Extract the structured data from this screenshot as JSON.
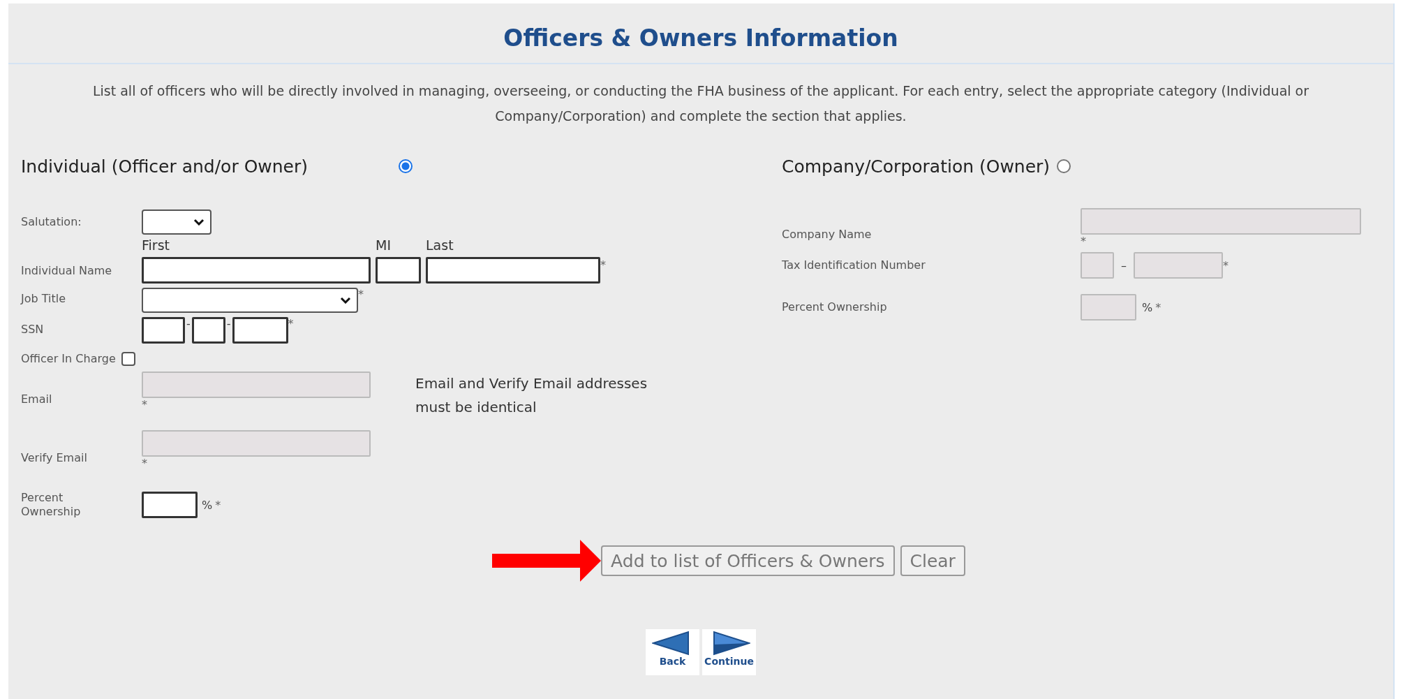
{
  "title": "Officers & Owners Information",
  "intro": "List all of officers who will be directly involved in managing, overseeing, or conducting the FHA business of the applicant. For each entry, select the appropriate category (Individual or Company/Corporation) and complete the section that applies.",
  "individual": {
    "heading": "Individual (Officer and/or Owner)",
    "selected": true,
    "rows": [
      {
        "kind": "salutation",
        "label": "Salutation:"
      },
      {
        "kind": "name",
        "label": "Individual Name",
        "parts": [
          "First",
          "MI",
          "Last"
        ],
        "required": "*"
      },
      {
        "kind": "job",
        "label": "Job Title",
        "required": "*"
      },
      {
        "kind": "ssn",
        "label": "SSN",
        "separators": [
          "-",
          "-"
        ],
        "required": "*"
      },
      {
        "kind": "checkbox",
        "label": "Officer In Charge",
        "checked": false
      },
      {
        "kind": "email",
        "label": "Email",
        "required": "*",
        "disabled": true
      },
      {
        "kind": "email",
        "label": "Verify Email",
        "required": "*",
        "disabled": true
      },
      {
        "kind": "percent",
        "label": "Percent Ownership",
        "unit": "%",
        "required": "*",
        "disabled": false
      }
    ],
    "note": "Email and Verify Email addresses must be identical"
  },
  "company": {
    "heading": "Company/Corporation (Owner)",
    "selected": false,
    "rows": [
      {
        "kind": "text",
        "label": "Company Name",
        "required": "*",
        "disabled": true
      },
      {
        "kind": "tin",
        "label": "Tax Identification Number",
        "separator": "–",
        "required": "*",
        "disabled": true
      },
      {
        "kind": "percent",
        "label": "Percent Ownership",
        "unit": "%",
        "required": "*",
        "disabled": true
      }
    ]
  },
  "buttons": [
    "Add to list of Officers & Owners",
    "Clear"
  ],
  "nav": [
    "Back",
    "Continue"
  ]
}
